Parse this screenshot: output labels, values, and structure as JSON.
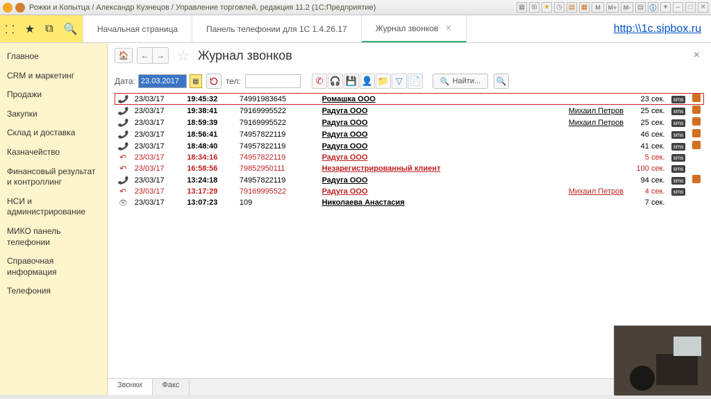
{
  "titlebar": {
    "text": "Рожки и Копытца / Александр Кузнецов / Управление торговлей, редакция 11.2  (1С:Предприятие)"
  },
  "tabs": {
    "items": [
      {
        "label": "Начальная страница"
      },
      {
        "label": "Панель телефонии для 1С 1.4.26.17"
      },
      {
        "label": "Журнал звонков"
      }
    ],
    "link": "http:\\\\1c.sipbox.ru"
  },
  "sidebar": {
    "items": [
      "Главное",
      "CRM и маркетинг",
      "Продажи",
      "Закупки",
      "Склад и доставка",
      "Казначейство",
      "Финансовый результат и контроллинг",
      "НСИ и администрирование",
      "МИКО панель телефонии",
      "Справочная информация",
      "Телефония"
    ]
  },
  "page": {
    "title": "Журнал звонков"
  },
  "filter": {
    "date_label": "Дата:",
    "date_value": "23.03.2017",
    "tel_label": "тел:",
    "tel_value": "",
    "find_label": "Найти..."
  },
  "rows": [
    {
      "icon": "call",
      "date": "23/03/17",
      "time": "19:45:32",
      "phone": "74991983645",
      "client": "Ромашка ООО",
      "person": "",
      "dur": "23 сек.",
      "sms": true,
      "audio": true,
      "red": false,
      "hl": true
    },
    {
      "icon": "call",
      "date": "23/03/17",
      "time": "19:38:41",
      "phone": "79169995522",
      "client": "Радуга ООО",
      "person": "Михаил Петров",
      "dur": "25 сек.",
      "sms": true,
      "audio": true,
      "red": false
    },
    {
      "icon": "call",
      "date": "23/03/17",
      "time": "18:59:39",
      "phone": "79169995522",
      "client": "Радуга ООО",
      "person": "Михаил Петров",
      "dur": "25 сек.",
      "sms": true,
      "audio": true,
      "red": false
    },
    {
      "icon": "call",
      "date": "23/03/17",
      "time": "18:56:41",
      "phone": "74957822119",
      "client": "Радуга ООО",
      "person": "",
      "dur": "46 сек.",
      "sms": true,
      "audio": true,
      "red": false
    },
    {
      "icon": "call",
      "date": "23/03/17",
      "time": "18:48:40",
      "phone": "74957822119",
      "client": "Радуга ООО",
      "person": "",
      "dur": "41 сек.",
      "sms": true,
      "audio": true,
      "red": false
    },
    {
      "icon": "miss",
      "date": "23/03/17",
      "time": "18:34:16",
      "phone": "74957822119",
      "client": "Радуга ООО",
      "person": "",
      "dur": "5 сек.",
      "sms": true,
      "audio": false,
      "red": true
    },
    {
      "icon": "miss",
      "date": "23/03/17",
      "time": "16:58:56",
      "phone": "79852950111",
      "client": "Незарегистрированный клиент",
      "person": "",
      "dur": "100 сек.",
      "sms": true,
      "audio": false,
      "red": true
    },
    {
      "icon": "call",
      "date": "23/03/17",
      "time": "13:24:18",
      "phone": "74957822119",
      "client": "Радуга ООО",
      "person": "",
      "dur": "94 сек.",
      "sms": true,
      "audio": true,
      "red": false
    },
    {
      "icon": "miss",
      "date": "23/03/17",
      "time": "13:17:29",
      "phone": "79169995522",
      "client": "Радуга ООО",
      "person": "Михаил Петров",
      "dur": "4 сек.",
      "sms": true,
      "audio": false,
      "red": true
    },
    {
      "icon": "eye",
      "date": "23/03/17",
      "time": "13:07:23",
      "phone": "109",
      "client": "Николаева Анастасия",
      "person": "",
      "dur": "7 сек.",
      "sms": false,
      "audio": false,
      "red": false
    }
  ],
  "bottom_tabs": {
    "calls": "Звонки",
    "fax": "Факс"
  }
}
